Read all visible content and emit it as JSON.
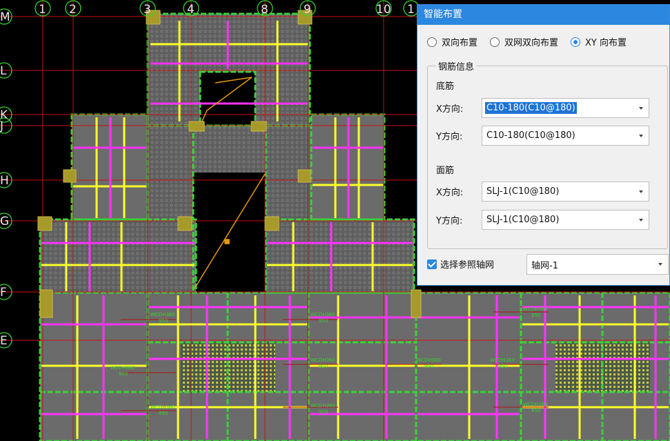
{
  "axes": {
    "top": [
      "1",
      "2",
      "3",
      "4",
      "8",
      "9",
      "10",
      "1"
    ],
    "left": [
      "M",
      "L",
      "K",
      "J",
      "H",
      "G",
      "F",
      "E"
    ]
  },
  "drawing_tag": "WCDH360",
  "drawing_tag2": "950",
  "dialog": {
    "title": "智能布置",
    "radios": [
      {
        "label": "双向布置",
        "selected": false
      },
      {
        "label": "双网双向布置",
        "selected": false
      },
      {
        "label": "XY 向布置",
        "selected": true
      }
    ],
    "group_title": "钢筋信息",
    "bottom": {
      "title": "底筋",
      "x_label": "X方向:",
      "x_value": "C10-180(C10@180)",
      "y_label": "Y方向:",
      "y_value": "C10-180(C10@180)"
    },
    "top": {
      "title": "面筋",
      "x_label": "X方向:",
      "x_value": "SLJ-1(C10@180)",
      "y_label": "Y方向:",
      "y_value": "SLJ-1(C10@180)"
    },
    "ref_checkbox": {
      "label": "选择参照轴网",
      "checked": true
    },
    "grid_value": "轴网-1"
  },
  "colors": {
    "slab": "#6b6b6b",
    "beam": "#3ad23a",
    "yellow_bar": "#ffff2a",
    "magenta_bar": "#ff33ff",
    "axis_line": "#cc1111",
    "column": "#a89a2a",
    "accent": "#2c87e0"
  }
}
